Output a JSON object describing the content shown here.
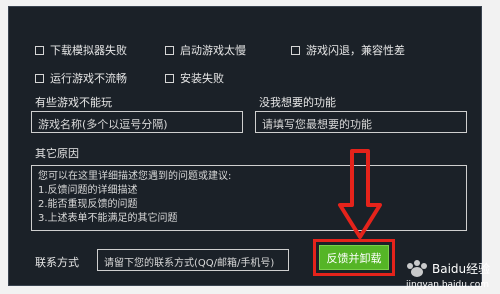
{
  "issues": {
    "row1": [
      {
        "label": "下载模拟器失败"
      },
      {
        "label": "启动游戏太慢"
      },
      {
        "label": "游戏闪退，兼容性差"
      }
    ],
    "row2": [
      {
        "label": "运行游戏不流畅"
      },
      {
        "label": "安装失败"
      }
    ]
  },
  "games": {
    "label": "有些游戏不能玩",
    "placeholder": "游戏名称(多个以逗号分隔)"
  },
  "features": {
    "label": "没我想要的功能",
    "placeholder": "请填写您最想要的功能"
  },
  "other": {
    "label": "其它原因",
    "lines": [
      "您可以在这里详细描述您遇到的问题或建议:",
      "1.反馈问题的详细描述",
      "2.能否重现反馈的问题",
      "3.上述表单不能满足的其它问题"
    ]
  },
  "contact": {
    "label": "联系方式",
    "placeholder": "请留下您的联系方式(QQ/邮箱/手机号)"
  },
  "submit": {
    "label": "反馈并卸载"
  },
  "watermark": {
    "brand": "Baidu经验",
    "url": "jingyan.baidu.com"
  },
  "colors": {
    "background": "#1b2128",
    "submit": "#55b526",
    "annotation": "#e5231b"
  }
}
